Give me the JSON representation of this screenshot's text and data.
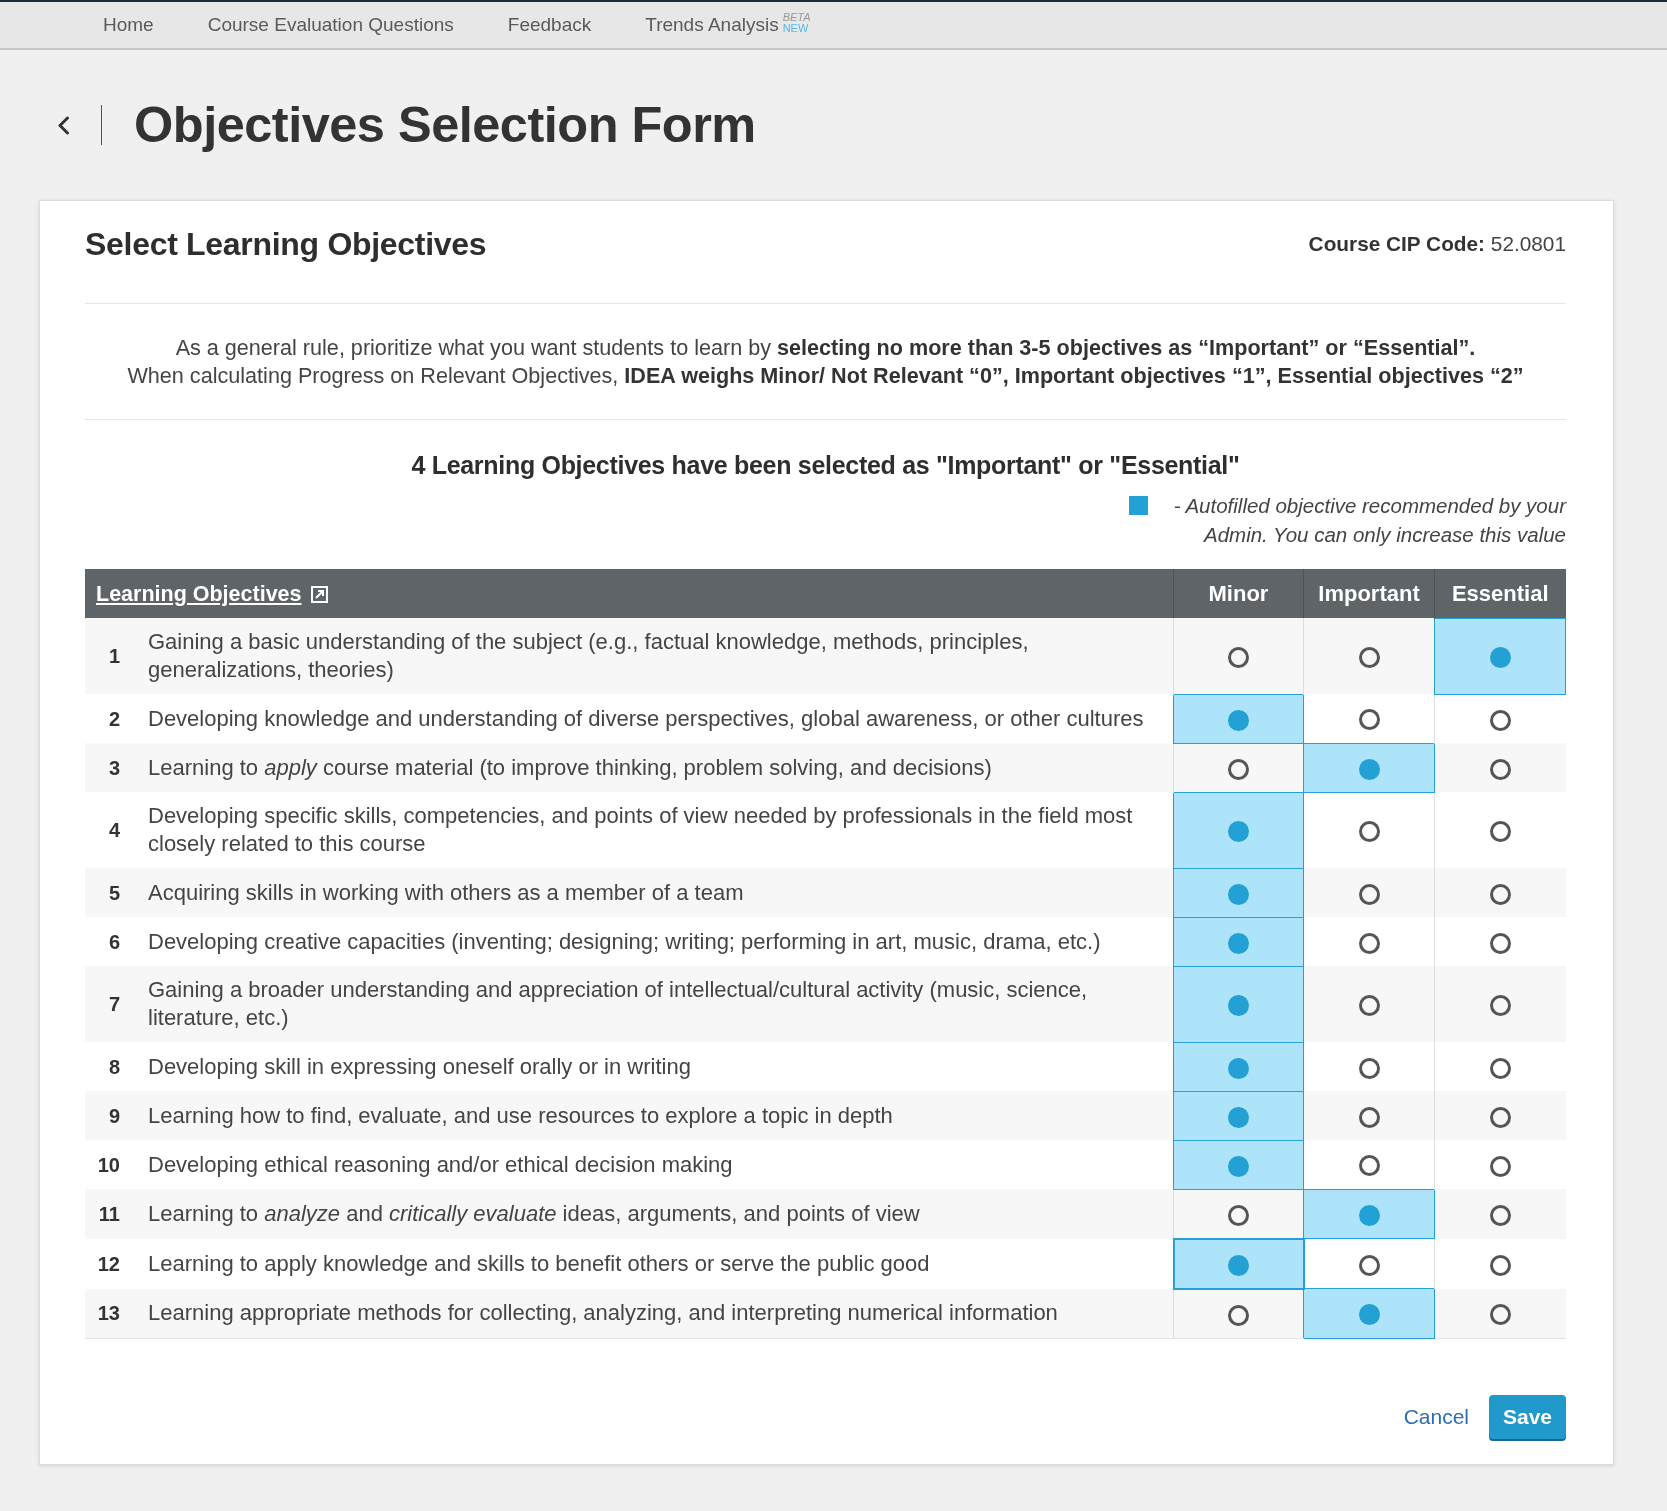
{
  "nav": {
    "items": [
      {
        "label": "Home"
      },
      {
        "label": "Course Evaluation Questions"
      },
      {
        "label": "Feedback"
      },
      {
        "label": "Trends Analysis",
        "tags": [
          {
            "kind": "beta",
            "text": "BETA"
          },
          {
            "kind": "new",
            "text": "NEW"
          }
        ]
      }
    ]
  },
  "page": {
    "title": "Objectives Selection Form"
  },
  "form": {
    "title": "Select Learning Objectives",
    "cip_code": "**Course CIP Code:** 52.0801",
    "guidance": [
      "As a general rule, prioritize what you want students to learn by **selecting no more than 3-5 objectives as “Important” or “Essential”.**",
      "When calculating Progress on Relevant Objectives, **IDEA weighs Minor/ Not Relevant “0”, Important objectives “1”, Essential objectives “2”**"
    ],
    "summary": "4 Learning Objectives have been selected as \"Important\" or \"Essential\"",
    "legend": "- Autofilled objective recommended by your Admin. You can only increase this value"
  },
  "table": {
    "columns": [
      {
        "kind": "link",
        "label": "Learning Objectives"
      },
      {
        "kind": "rating",
        "label": "Minor"
      },
      {
        "kind": "rating",
        "label": "Important"
      },
      {
        "kind": "rating",
        "label": "Essential"
      }
    ],
    "rows": [
      {
        "number": "1",
        "text": "Gaining a basic understanding of the subject (e.g., factual knowledge, methods, principles, generalizations, theories)",
        "options": [
          {
            "selected": false,
            "focused": false
          },
          {
            "selected": false,
            "focused": false
          },
          {
            "selected": true,
            "focused": false
          }
        ]
      },
      {
        "number": "2",
        "text": "Developing knowledge and understanding of diverse perspectives, global awareness, or other cultures",
        "options": [
          {
            "selected": true,
            "focused": false
          },
          {
            "selected": false,
            "focused": false
          },
          {
            "selected": false,
            "focused": false
          }
        ]
      },
      {
        "number": "3",
        "text": "Learning to *apply* course material (to improve thinking, problem solving, and decisions)",
        "options": [
          {
            "selected": false,
            "focused": false
          },
          {
            "selected": true,
            "focused": false
          },
          {
            "selected": false,
            "focused": false
          }
        ]
      },
      {
        "number": "4",
        "text": "Developing specific skills, competencies, and points of view needed by professionals in the field most closely related to this course",
        "options": [
          {
            "selected": true,
            "focused": false
          },
          {
            "selected": false,
            "focused": false
          },
          {
            "selected": false,
            "focused": false
          }
        ]
      },
      {
        "number": "5",
        "text": "Acquiring skills in working with others as a member of a team",
        "options": [
          {
            "selected": true,
            "focused": false
          },
          {
            "selected": false,
            "focused": false
          },
          {
            "selected": false,
            "focused": false
          }
        ]
      },
      {
        "number": "6",
        "text": "Developing creative capacities (inventing; designing; writing; performing in art, music, drama, etc.)",
        "options": [
          {
            "selected": true,
            "focused": false
          },
          {
            "selected": false,
            "focused": false
          },
          {
            "selected": false,
            "focused": false
          }
        ]
      },
      {
        "number": "7",
        "text": "Gaining a broader understanding and appreciation of intellectual/cultural activity (music, science, literature, etc.)",
        "options": [
          {
            "selected": true,
            "focused": false
          },
          {
            "selected": false,
            "focused": false
          },
          {
            "selected": false,
            "focused": false
          }
        ]
      },
      {
        "number": "8",
        "text": "Developing skill in expressing oneself orally or in writing",
        "options": [
          {
            "selected": true,
            "focused": false
          },
          {
            "selected": false,
            "focused": false
          },
          {
            "selected": false,
            "focused": false
          }
        ]
      },
      {
        "number": "9",
        "text": "Learning how to find, evaluate, and use resources to explore a topic in depth",
        "options": [
          {
            "selected": true,
            "focused": false
          },
          {
            "selected": false,
            "focused": false
          },
          {
            "selected": false,
            "focused": false
          }
        ]
      },
      {
        "number": "10",
        "text": "Developing ethical reasoning and/or ethical decision making",
        "options": [
          {
            "selected": true,
            "focused": false
          },
          {
            "selected": false,
            "focused": false
          },
          {
            "selected": false,
            "focused": false
          }
        ]
      },
      {
        "number": "11",
        "text": "Learning to *analyze* and *critically evaluate* ideas, arguments, and points of view",
        "options": [
          {
            "selected": false,
            "focused": false
          },
          {
            "selected": true,
            "focused": false
          },
          {
            "selected": false,
            "focused": false
          }
        ]
      },
      {
        "number": "12",
        "text": "Learning to apply knowledge and skills to benefit others or serve the public good",
        "options": [
          {
            "selected": true,
            "focused": true
          },
          {
            "selected": false,
            "focused": false
          },
          {
            "selected": false,
            "focused": false
          }
        ]
      },
      {
        "number": "13",
        "text": "Learning appropriate methods for collecting, analyzing, and interpreting numerical information",
        "options": [
          {
            "selected": false,
            "focused": false
          },
          {
            "selected": true,
            "focused": false
          },
          {
            "selected": false,
            "focused": false
          }
        ]
      }
    ]
  },
  "actions": {
    "cancel": "Cancel",
    "save": "Save"
  }
}
